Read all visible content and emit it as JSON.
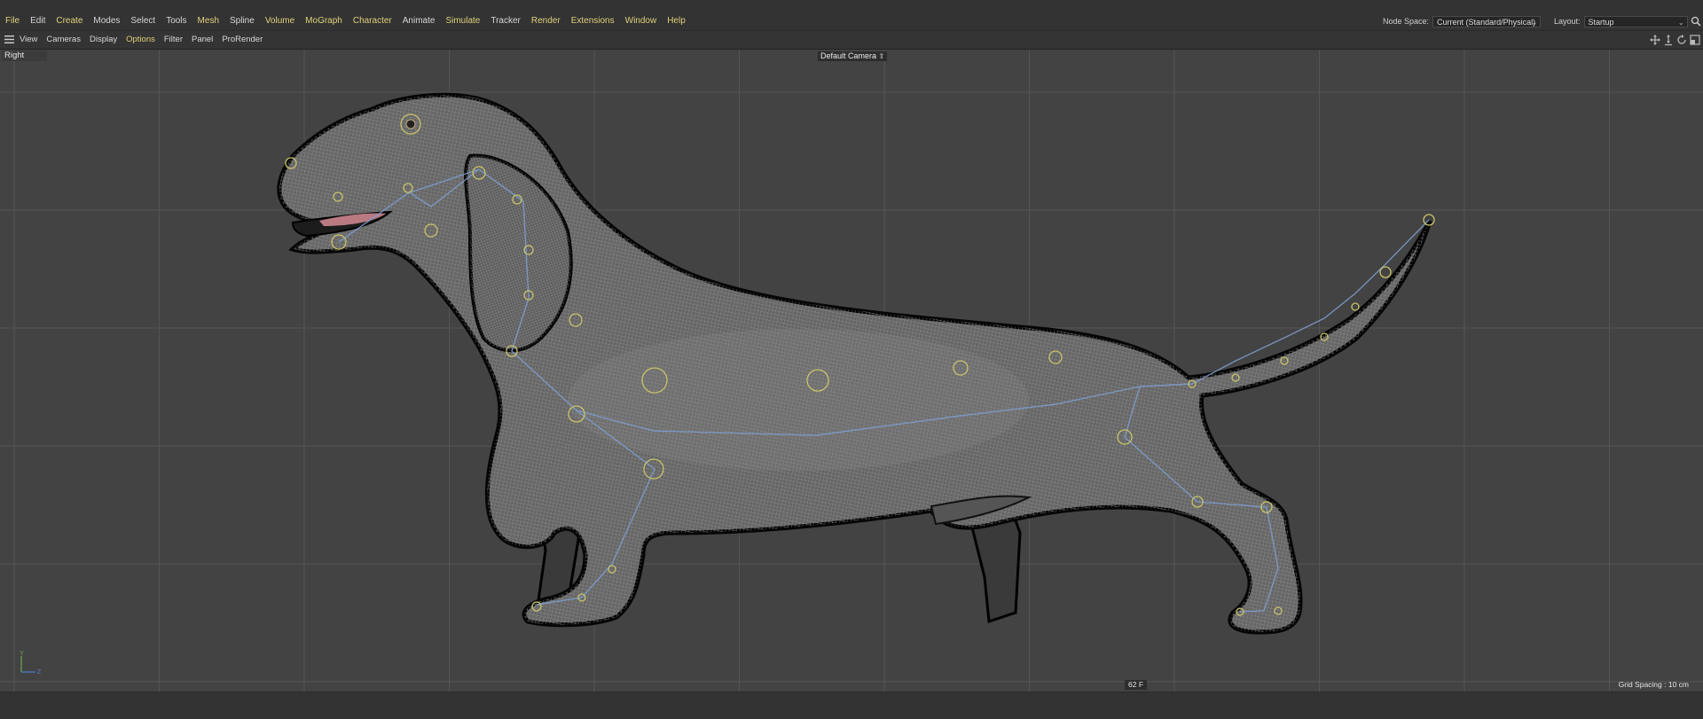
{
  "menubar": {
    "items": [
      {
        "label": "File",
        "style": "hl"
      },
      {
        "label": "Edit",
        "style": "plain"
      },
      {
        "label": "Create",
        "style": "hl"
      },
      {
        "label": "Modes",
        "style": "plain"
      },
      {
        "label": "Select",
        "style": "plain"
      },
      {
        "label": "Tools",
        "style": "plain"
      },
      {
        "label": "Mesh",
        "style": "hl"
      },
      {
        "label": "Spline",
        "style": "plain"
      },
      {
        "label": "Volume",
        "style": "hl"
      },
      {
        "label": "MoGraph",
        "style": "hl"
      },
      {
        "label": "Character",
        "style": "hl"
      },
      {
        "label": "Animate",
        "style": "plain"
      },
      {
        "label": "Simulate",
        "style": "hl"
      },
      {
        "label": "Tracker",
        "style": "plain"
      },
      {
        "label": "Render",
        "style": "hl"
      },
      {
        "label": "Extensions",
        "style": "hl"
      },
      {
        "label": "Window",
        "style": "hl"
      },
      {
        "label": "Help",
        "style": "hl"
      }
    ],
    "node_space_label": "Node Space:",
    "node_space_value": "Current (Standard/Physical)",
    "layout_label": "Layout:",
    "layout_value": "Startup",
    "search_icon": "search-icon"
  },
  "viewbar": {
    "menus": [
      {
        "label": "View",
        "style": "plain"
      },
      {
        "label": "Cameras",
        "style": "plain"
      },
      {
        "label": "Display",
        "style": "plain"
      },
      {
        "label": "Options",
        "style": "hl"
      },
      {
        "label": "Filter",
        "style": "plain"
      },
      {
        "label": "Panel",
        "style": "plain"
      },
      {
        "label": "ProRender",
        "style": "plain"
      }
    ],
    "nav_icons": [
      "move-view-icon",
      "zoom-view-icon",
      "rotate-view-icon",
      "toggle-view-icon"
    ]
  },
  "viewport": {
    "name": "Right",
    "camera": "Default Camera",
    "frame": "62 F",
    "grid_spacing": "Grid Spacing : 10 cm",
    "axis_labels": {
      "y": "Y",
      "z": "Z"
    }
  },
  "colors": {
    "accent_menu": "#e0d07a",
    "viewport_bg": "#434343",
    "grid_line": "#535353",
    "mesh": "#d8d8d8",
    "joint": "#c9c46a",
    "bone": "#7f9fd0"
  }
}
